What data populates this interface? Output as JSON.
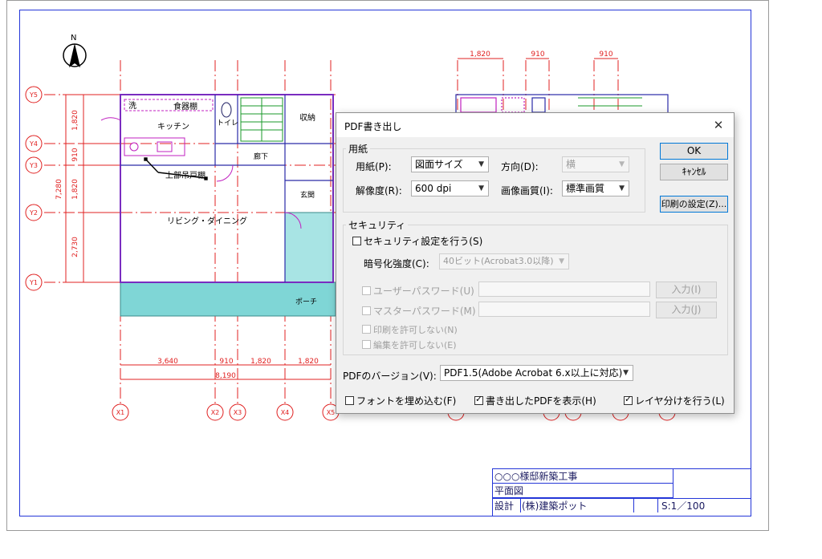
{
  "drawing": {
    "north_label": "N",
    "grid_y": [
      "Y5",
      "Y4",
      "Y3",
      "Y2",
      "Y1"
    ],
    "grid_x": [
      "X1",
      "X2",
      "X3",
      "X4",
      "X5"
    ],
    "dims_left": [
      "1,820",
      "910",
      "1,820",
      "2,730"
    ],
    "dim_left_total": "7,280",
    "dims_bottom": [
      "3,640",
      "910",
      "1,820",
      "1,820"
    ],
    "dim_bottom_total": "8,190",
    "dims_top_right": [
      "1,820",
      "910",
      "910"
    ],
    "rooms": {
      "wash": "洗",
      "storage_room": "食器棚",
      "kitchen": "キッチン",
      "toilet": "トイレ",
      "closet": "収納",
      "hall": "廊下",
      "wall_cabinet": "上部吊戸棚",
      "entrance": "玄関",
      "living": "リビング・ダイニング",
      "porch": "ポーチ"
    }
  },
  "title_block": {
    "project": "○○○様邸新築工事",
    "drawing_name": "平面図",
    "designer_label": "設計",
    "company": "(株)建築ポット",
    "scale": "S:1／100"
  },
  "dialog": {
    "title": "PDF書き出し",
    "paper_group": "用紙",
    "paper_label": "用紙(P):",
    "paper_value": "図面サイズ",
    "orientation_label": "方向(D):",
    "orientation_value": "横",
    "resolution_label": "解像度(R):",
    "resolution_value": "600 dpi",
    "image_quality_label": "画像画質(I):",
    "image_quality_value": "標準画質",
    "ok": "OK",
    "cancel": "ｷｬﾝｾﾙ",
    "print_settings": "印刷の設定(Z)...",
    "security_group": "セキュリティ",
    "security_check": "セキュリティ設定を行う(S)",
    "encryption_label": "暗号化強度(C):",
    "encryption_value": "40ビット(Acrobat3.0以降)",
    "user_password": "ユーザーパスワード(U)",
    "master_password": "マスターパスワード(M)",
    "input_i": "入力(I)",
    "input_j": "入力(J)",
    "no_print": "印刷を許可しない(N)",
    "no_edit": "編集を許可しない(E)",
    "pdf_version_label": "PDFのバージョン(V):",
    "pdf_version_value": "PDF1.5(Adobe Acrobat 6.x以上に対応)",
    "embed_fonts": "フォントを埋め込む(F)",
    "show_pdf": "書き出したPDFを表示(H)",
    "split_layers": "レイヤ分けを行う(L)",
    "embed_fonts_checked": false,
    "show_pdf_checked": true,
    "split_layers_checked": true,
    "security_checked": false
  }
}
